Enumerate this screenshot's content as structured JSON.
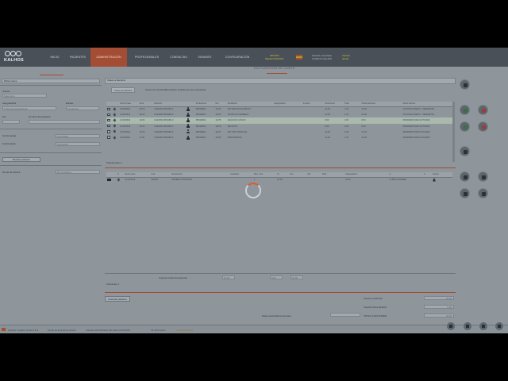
{
  "app": {
    "logo_text": "KALHOS",
    "nav": [
      "INICIO",
      "PACIENTES",
      "ADMINISTRACIÓN",
      "PROFESIONALES",
      "CONSULTAS",
      "ENVASES",
      "CONFIGURACIÓN"
    ],
    "nav_active_index": 2,
    "yellow_label": "OPCIÓN\nSELECCIONADA",
    "user_label": "Usuario conectado\nCLINICA CALHOS",
    "user_label2": "Versión\nactual",
    "colors": {
      "accent": "#a24d34",
      "topbar": "#4a5058",
      "background": "#8e959b",
      "spinner": "#e05a30"
    }
  },
  "page": {
    "title": "FACTURACIÓN DE CASOS"
  },
  "left": {
    "header": "Filtrar casos",
    "labels": [
      "Clínica",
      "Aseguradora",
      "Estado",
      "Nro",
      "Nombre del paciente",
      "Fecha desde",
      "Fecha hasta",
      "Buscar por paciente",
      "Nro/Id de factura"
    ],
    "values": {
      "clinica": "Seleccione",
      "aseguradora": "Todas las aseguradoras",
      "estado": "Pendientes",
      "fecha_desde": "01/10/2019",
      "fecha_hasta": "31/10/2019",
      "factura": "Nro de factura"
    },
    "button": "Buscar paciente"
  },
  "cases": {
    "header": "Casos a Facturar",
    "tabs": [
      "Casos pendientes",
      "Casos con Voucher/Bono/Orden emitidos por otro profesional"
    ],
    "columns": [
      "",
      "",
      "Fecha Caso",
      "Hora",
      "Paciente",
      "",
      "Profesional",
      "Nro",
      "Prestación",
      "Aseguradora",
      "Importe",
      "Descuento",
      "Total",
      "Observaciones",
      "Datos factura"
    ],
    "rows": [
      [
        "21/10/2019",
        "09:15",
        "CLIENTE PRUEBA 1",
        "PRUEBAS",
        "11273",
        "ESTUDIO ECOGRÁFICO",
        "",
        "",
        "22.00",
        "1.00",
        "21.00",
        "FACTURA PREVIA · PENDIENTE",
        "CLÍNICA PRUEBA"
      ],
      [
        "21/10/2019",
        "09:30",
        "CLIENTE PRUEBA 2",
        "PRUEBAS",
        "11274",
        "CONSULTA GENERAL",
        "",
        "",
        "22.00",
        "1.00",
        "21.00",
        "FACTURA PREVIA · PENDIENTE",
        "CLÍNICA PRUEBA"
      ],
      [
        "21/10/2019",
        "10:00",
        "CLIENTE PRUEBA 3",
        "PRUEBAS",
        "11275",
        "ANÁLISIS CLÍNICO",
        "",
        "",
        "8.00",
        "0.00",
        "8.00",
        "PENDIENTE DE FACTURAR",
        "CLÍNICA PRUEBA"
      ],
      [
        "21/10/2019",
        "10:15",
        "CLIENTE PRUEBA 4",
        "PRUEBAS",
        "11276",
        "REVISIÓN",
        "",
        "",
        "8.00",
        "0.00",
        "8.00",
        "PENDIENTE DE FACTURAR",
        "CLÍNICA PRUEBA"
      ],
      [
        "21/10/2019",
        "10:45",
        "CLIENTE PRUEBA 5",
        "PRUEBAS",
        "11277",
        "ESTUDIO ESPECIAL",
        "",
        "",
        "22.00",
        "1.00",
        "21.00",
        "PENDIENTE DE FACTURAR",
        "CLÍNICA PRUEBA"
      ],
      [
        "21/10/2019",
        "11:00",
        "CLIENTE PRUEBA 6",
        "PRUEBAS",
        "11278",
        "RADIOGRAFÍA",
        "",
        "",
        "22.00",
        "1.00",
        "21.00",
        "PENDIENTE DE FACTURAR",
        "CLÍNICA PRUEBA"
      ]
    ],
    "selected_row": 2,
    "footer": "Total de casos: 6"
  },
  "invoice": {
    "columns": [
      "",
      "N",
      "Fecha caso",
      "Cod",
      "Descripción",
      "Cantidad",
      "Prec. Unit",
      "%",
      "Imp.",
      "IVA",
      "Total",
      "Aseguradora",
      "A.",
      "A.",
      "Acción"
    ],
    "row": [
      "",
      "21/10/2019",
      "000025",
      "PRUEBA CONCEPTO",
      "",
      "1",
      "22.00",
      "",
      "",
      "",
      "22.00",
      "CLÍNICA PRUEBA",
      "",
      ""
    ],
    "footer_note": "Total líneas: 1",
    "totals_label": "Importes totales del paciente",
    "totals": [
      "22.00",
      "0.00",
      "22.00"
    ],
    "button": "Facturar paciente",
    "summary_labels": [
      "Importe a facturar",
      "Importe IVA a facturar",
      "TOTAL A FACTURAR"
    ],
    "summary_values": [
      "22.00",
      "0.00",
      "22.00"
    ],
    "datos_label": "Datos para factura del caso"
  },
  "statusbar": {
    "company": "Usuario: Imagine Smart S.R.L.",
    "text1": "Fecha de la próxima sesión:",
    "text2": "Usuario administrador del sistema KALHOS",
    "version": "V1.20.0 Activo",
    "link": "Configurar Perfil"
  }
}
